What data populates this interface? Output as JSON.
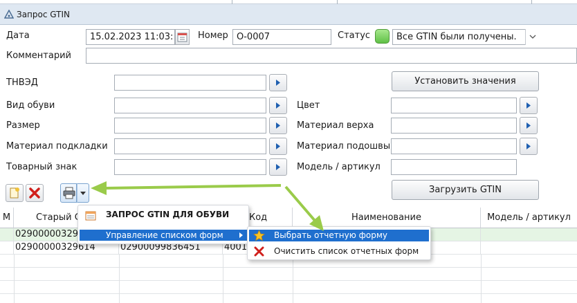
{
  "window": {
    "title": "Запрос GTIN"
  },
  "header": {
    "date_label": "Дата",
    "date_value": "15.02.2023 11:03:",
    "number_label": "Номер",
    "number_value": "О-0007",
    "status_label": "Статус",
    "status_value": "Все GTIN были получены.",
    "comment_label": "Комментарий",
    "comment_value": ""
  },
  "fields": {
    "tnved_label": "ТНВЭД",
    "shoe_type_label": "Вид обуви",
    "size_label": "Размер",
    "lining_label": "Материал подкладки",
    "trademark_label": "Товарный знак",
    "color_label": "Цвет",
    "upper_label": "Материал верха",
    "sole_label": "Материал подошвы",
    "model_label": "Модель / артикул"
  },
  "buttons": {
    "set_values": "Установить значения",
    "load_gtin": "Загрузить GTIN"
  },
  "table": {
    "columns": [
      "М",
      "Старый G",
      "Код",
      "Наименование",
      "Модель / артикул"
    ],
    "rows": [
      {
        "col1": "029000003296",
        "col2": "",
        "col3": ""
      },
      {
        "col1": "02900000329614",
        "col2": "02900099836451",
        "col3": "4001"
      }
    ]
  },
  "context_menu": {
    "title": "ЗАПРОС GTIN ДЛЯ ОБУВИ",
    "item": "Управление списком форм"
  },
  "submenu": {
    "item1": "Выбрать отчетную форму",
    "item2": "Очистить список отчетных форм"
  },
  "colors": {
    "arrow": "#9acb4a",
    "highlight": "#1f6fce",
    "selected_row": "#e5f5e4"
  }
}
